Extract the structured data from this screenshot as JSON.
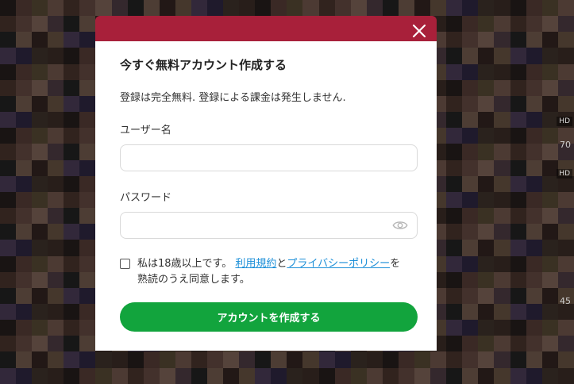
{
  "modal": {
    "title": "今すぐ無料アカウント作成する",
    "subtitle": "登録は完全無料. 登録による課金は発生しません.",
    "username_label": "ユーザー名",
    "username_value": "",
    "password_label": "パスワード",
    "password_value": "",
    "agree_prefix": "私は18歳以上です。",
    "terms_link": "利用規約",
    "agree_and": "と",
    "privacy_link": "プライバシーポリシー",
    "agree_suffix_1": "を",
    "agree_suffix_2": "熟読のうえ同意します。",
    "submit_label": "アカウントを作成する",
    "close_icon": "close-icon",
    "password_toggle_icon": "eye-icon"
  },
  "background": {
    "side_badges": [
      "HD",
      "HD"
    ],
    "partial_texts": [
      "70",
      "45"
    ]
  },
  "colors": {
    "header": "#a8203a",
    "submit": "#12a43d",
    "link": "#1c8fd8"
  }
}
